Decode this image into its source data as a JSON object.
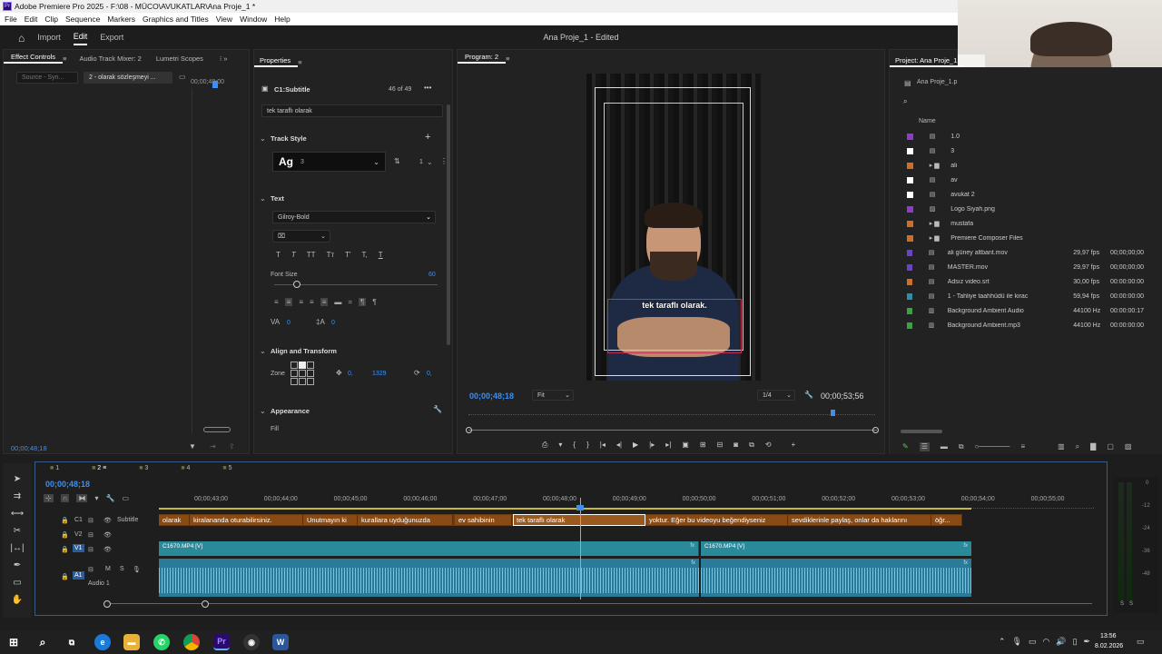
{
  "window_title": "Adobe Premiere Pro 2025 - F:\\08 - MÜCO\\AVUKATLAR\\Ana Proje_1 *",
  "menu": [
    "File",
    "Edit",
    "Clip",
    "Sequence",
    "Markers",
    "Graphics and Titles",
    "View",
    "Window",
    "Help"
  ],
  "workspaces": [
    "Import",
    "Edit",
    "Export"
  ],
  "document_title": "Ana Proje_1 - Edited",
  "effect_controls": {
    "tabs": [
      "Effect Controls",
      "Audio Track Mixer: 2",
      "Lumetri Scopes"
    ],
    "source_label": "Source - Syn...",
    "clip_label": "2 - olarak sözleşmeyi ...",
    "time_marker": "00;00;48;00",
    "timecode": "00;00;48;18"
  },
  "properties": {
    "title": "Properties",
    "layer": "C1:Subtitle",
    "count": "46 of 49",
    "text_value": "tek taraflı olarak",
    "track_style_header": "Track Style",
    "style_swatch": "Ag",
    "style_num": "3",
    "track_num": "1",
    "text_header": "Text",
    "font": "Gilroy-Bold",
    "font_size_label": "Font Size",
    "font_size": "60",
    "num_a": "0",
    "num_b": "0",
    "align_header": "Align and Transform",
    "zone_label": "Zone",
    "pos_x": "0,",
    "pos_y": "1329",
    "rot": "0,",
    "appearance_header": "Appearance",
    "fill_label": "Fill"
  },
  "program": {
    "title": "Program: 2",
    "caption": "tek taraflı olarak.",
    "current_time": "00;00;48;18",
    "fit": "Fit",
    "quality": "1/4",
    "duration": "00;00;53;56"
  },
  "project": {
    "title": "Project: Ana Proje_1",
    "bin": "Ana Proje_1.p",
    "name_header": "Name",
    "items": [
      {
        "name": "1.0",
        "color": "#8e3bd0",
        "fps": "",
        "start": "",
        "icon": "seq"
      },
      {
        "name": "3",
        "color": "#ffffff",
        "fps": "",
        "start": "",
        "icon": "seq"
      },
      {
        "name": "ali",
        "color": "#d56c1e",
        "fps": "",
        "start": "",
        "icon": "folder"
      },
      {
        "name": "av",
        "color": "#ffffff",
        "fps": "",
        "start": "",
        "icon": "seq"
      },
      {
        "name": "avukat 2",
        "color": "#ffffff",
        "fps": "",
        "start": "",
        "icon": "seq"
      },
      {
        "name": "Logo Siyah.png",
        "color": "#8e3bd0",
        "fps": "",
        "start": "",
        "icon": "img"
      },
      {
        "name": "mustafa",
        "color": "#d56c1e",
        "fps": "",
        "start": "",
        "icon": "folder"
      },
      {
        "name": "Premiere Composer Files",
        "color": "#d56c1e",
        "fps": "",
        "start": "",
        "icon": "folder"
      },
      {
        "name": "ali güney altbant.mov",
        "color": "#6b3fd0",
        "fps": "29,97 fps",
        "start": "00;00;00;00",
        "icon": "vid"
      },
      {
        "name": "MASTER.mov",
        "color": "#6b3fd0",
        "fps": "29,97 fps",
        "start": "00;00;00;00",
        "icon": "vid"
      },
      {
        "name": "Adsız video.srt",
        "color": "#d56c1e",
        "fps": "30,00 fps",
        "start": "00:00:00:00",
        "icon": "srt"
      },
      {
        "name": "1 - Tahliye taahhüdü ile kirac",
        "color": "#2a8fb0",
        "fps": "59,94 fps",
        "start": "00:00:00:00",
        "icon": "vid"
      },
      {
        "name": "Background Ambient Audio",
        "color": "#3aa33a",
        "fps": "44100 Hz",
        "start": "00:00:00:17",
        "icon": "aud"
      },
      {
        "name": "Background Ambient.mp3",
        "color": "#3aa33a",
        "fps": "44100 Hz",
        "start": "00:00:00:00",
        "icon": "aud"
      }
    ]
  },
  "timeline": {
    "tabs": [
      "1",
      "2",
      "3",
      "4",
      "5"
    ],
    "timecode": "00;00;48;18",
    "ruler": [
      "00;00;43;00",
      "00;00;44;00",
      "00;00;45;00",
      "00;00;46;00",
      "00;00;47;00",
      "00;00;48;00",
      "00;00;49;00",
      "00;00;50;00",
      "00;00;51;00",
      "00;00;52;00",
      "00;00;53;00",
      "00;00;54;00",
      "00;00;55;00"
    ],
    "tracks": {
      "c1": "C1",
      "subtitle": "Subtitle",
      "v2": "V2",
      "v1": "V1",
      "a1": "A1",
      "audio1": "Audio 1",
      "m": "M",
      "s": "S"
    },
    "captions": [
      "olarak",
      "kiralananda oturabilirsiniz.",
      "Unutmayın ki",
      "kurallara uyduğunuzda",
      "ev sahibinin",
      "tek taraflı olarak",
      "yoktur. Eğer bu videoyu beğendiyseniz",
      "sevdiklerinle paylaş, onlar da haklarını",
      "öğr..."
    ],
    "video_clips": [
      "C1670.MP4 [V]",
      "C1670.MP4 [V]"
    ],
    "fx": "fx"
  },
  "meters": {
    "labels": [
      "0",
      "-12",
      "-24",
      "-36",
      "-48"
    ],
    "s": "S"
  },
  "clock": {
    "time": "13:56",
    "date": "8.02.2026"
  }
}
